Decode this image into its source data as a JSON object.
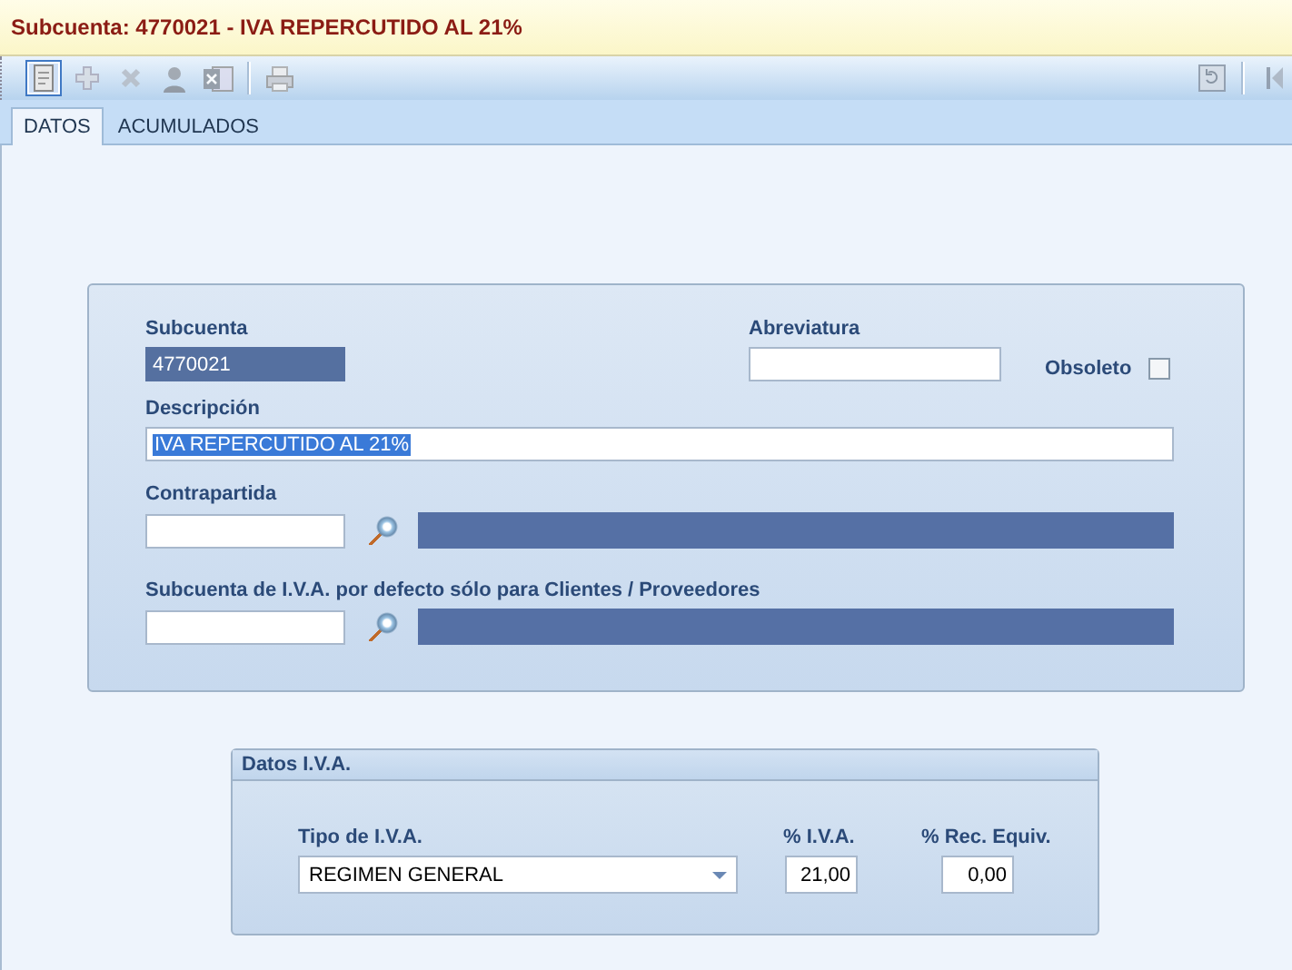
{
  "window": {
    "title": "Subcuenta: 4770021 - IVA REPERCUTIDO AL 21%"
  },
  "toolbar": [
    {
      "kind": "document",
      "selected": true
    },
    {
      "kind": "plus",
      "selected": false
    },
    {
      "kind": "cross",
      "selected": false
    },
    {
      "kind": "person",
      "selected": false
    },
    {
      "kind": "spreadsheet",
      "selected": false
    },
    {
      "kind": "separator"
    },
    {
      "kind": "printer",
      "selected": false
    }
  ],
  "toolbar_right": [
    {
      "kind": "refresh"
    },
    {
      "kind": "separator"
    },
    {
      "kind": "first"
    }
  ],
  "tabs": [
    {
      "label": "DATOS",
      "selected": true
    },
    {
      "label": "ACUMULADOS",
      "selected": false
    }
  ],
  "subcuenta": {
    "label": "Subcuenta",
    "value": "4770021",
    "readonly": true
  },
  "abreviatura": {
    "label": "Abreviatura"
  },
  "obsoleto": {
    "label": "Obsoleto",
    "checked": false
  },
  "descripcion": {
    "label": "Descripción",
    "value": "IVA REPERCUTIDO AL 21%",
    "highlighted": true
  },
  "contrapartida": {
    "label": "Contrapartida"
  },
  "subcuenta_iva": {
    "label": "Subcuenta de I.V.A. por defecto sólo para Clientes / Proveedores"
  },
  "datos_iva": {
    "title": "Datos I.V.A.",
    "tipo": {
      "label": "Tipo de I.V.A.",
      "value": "REGIMEN GENERAL"
    },
    "pct_iva": {
      "label": "% I.V.A.",
      "value": "21,00"
    },
    "rec_equiv": {
      "label": "% Rec. Equiv.",
      "value": "0,00"
    }
  }
}
